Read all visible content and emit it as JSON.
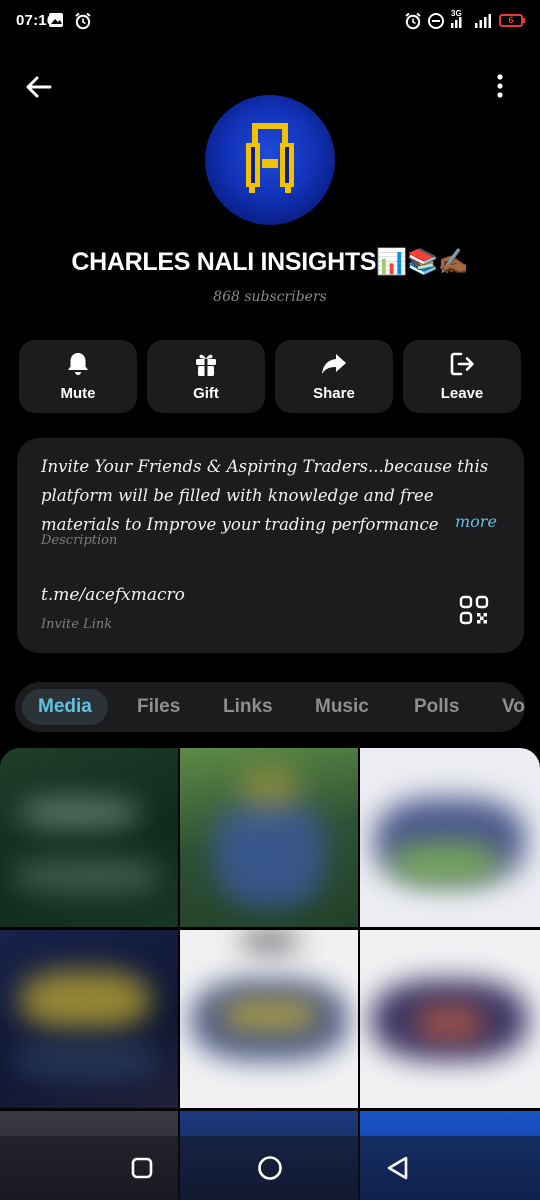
{
  "status_bar": {
    "time": "07:16",
    "network": "3G",
    "battery": "6",
    "icons": [
      "gallery-icon",
      "alarm-icon",
      "alarm-icon",
      "do-not-disturb-icon",
      "signal-icon",
      "signal-icon",
      "battery-icon"
    ]
  },
  "header": {
    "back_icon": "arrow-left-icon",
    "menu_icon": "more-vertical-icon"
  },
  "channel": {
    "title": "CHARLES NALI INSIGHTS📊📚✍🏾",
    "subscribers": "868 subscribers"
  },
  "actions": [
    {
      "label": "Mute",
      "icon": "bell-icon"
    },
    {
      "label": "Gift",
      "icon": "gift-icon"
    },
    {
      "label": "Share",
      "icon": "share-arrow-icon"
    },
    {
      "label": "Leave",
      "icon": "leave-icon"
    }
  ],
  "info": {
    "description": "Invite Your Friends & Aspiring Traders...because this platform will be filled with knowledge and free materials to Improve your trading performance",
    "more_label": "more",
    "description_label": "Description",
    "invite_link": "t.me/acefxmacro",
    "invite_link_label": "Invite Link"
  },
  "tabs": [
    {
      "label": "Media",
      "active": true
    },
    {
      "label": "Files",
      "active": false
    },
    {
      "label": "Links",
      "active": false
    },
    {
      "label": "Music",
      "active": false
    },
    {
      "label": "Polls",
      "active": false
    },
    {
      "label": "Vo",
      "active": false
    }
  ],
  "colors": {
    "background": "#000000",
    "card": "#1c1c1e",
    "accent": "#5ec2e0",
    "muted_text": "#8e8e93",
    "avatar_blue": "#1233b8",
    "logo_yellow": "#f2c200",
    "battery_low": "#e53935"
  },
  "nav_bar": {
    "buttons": [
      "square-recents-icon",
      "circle-home-icon",
      "triangle-back-icon"
    ]
  }
}
